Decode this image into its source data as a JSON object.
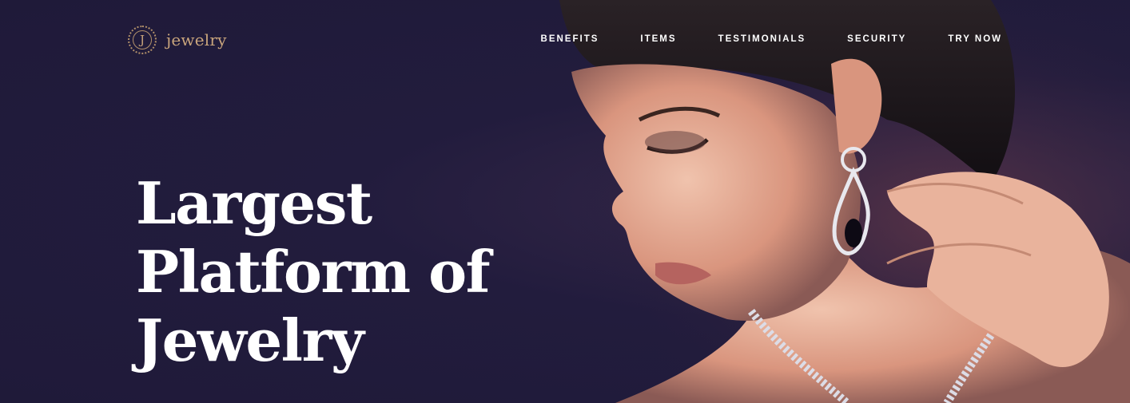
{
  "brand": {
    "logo_letter": "J",
    "name": "jewelry"
  },
  "nav": {
    "items": [
      {
        "label": "BENEFITS"
      },
      {
        "label": "ITEMS"
      },
      {
        "label": "TESTIMONIALS"
      },
      {
        "label": "SECURITY"
      },
      {
        "label": "TRY NOW"
      }
    ]
  },
  "hero": {
    "headline": "Largest Platform of Jewelry",
    "image": "woman-with-diamond-earring-and-necklace"
  },
  "colors": {
    "background": "#201b3b",
    "accent_gold": "#c9a57c",
    "text": "#ffffff"
  }
}
